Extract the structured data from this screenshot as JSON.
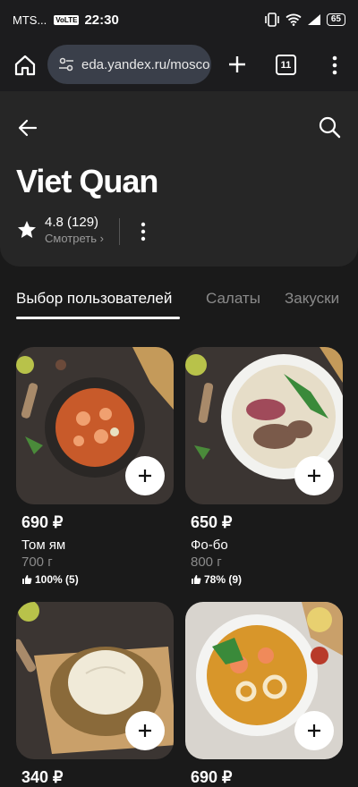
{
  "status_bar": {
    "carrier": "MTS...",
    "volte": "VoLTE",
    "time": "22:30",
    "battery": "65"
  },
  "browser": {
    "url": "eda.yandex.ru/mosco",
    "tabs_count": "11"
  },
  "restaurant": {
    "name": "Viet Quan",
    "rating": "4.8 (129)",
    "rating_link": "Смотреть ›"
  },
  "tabs": [
    {
      "label": "Выбор пользователей",
      "active": true
    },
    {
      "label": "Салаты",
      "active": false
    },
    {
      "label": "Закуски",
      "active": false
    }
  ],
  "products": [
    {
      "price": "690 ₽",
      "name": "Том ям",
      "weight": "700 г",
      "likes": "100% (5)"
    },
    {
      "price": "650 ₽",
      "name": "Фо-бо",
      "weight": "800 г",
      "likes": "78% (9)"
    },
    {
      "price": "340 ₽"
    },
    {
      "price": "690 ₽"
    }
  ],
  "colors": {
    "background": "#1a1a1a",
    "header": "#262626",
    "urlbar": "#3a3f4a",
    "muted_text": "#8a8a8a"
  }
}
